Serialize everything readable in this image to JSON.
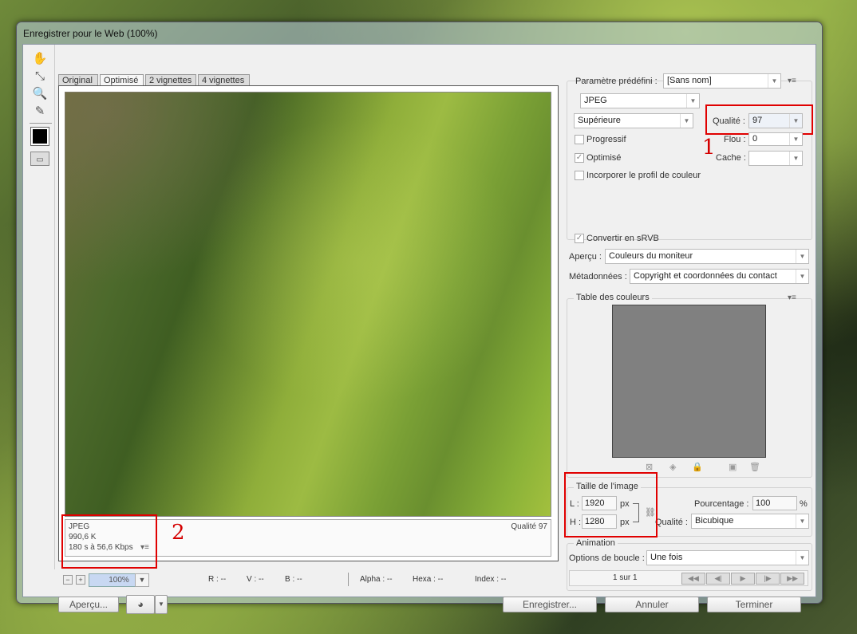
{
  "window": {
    "title": "Enregistrer pour le Web (100%)"
  },
  "tabs": [
    "Original",
    "Optimisé",
    "2 vignettes",
    "4 vignettes"
  ],
  "preview": {
    "info_format": "JPEG",
    "info_size": "990,6 K",
    "info_time": "180 s à 56,6 Kbps",
    "info_quality": "Qualité 97"
  },
  "status": {
    "zoom": "100%",
    "r": "R : --",
    "v": "V : --",
    "b": "B : --",
    "alpha": "Alpha : --",
    "hexa": "Hexa : --",
    "index": "Index : --"
  },
  "annotations": {
    "one": "1",
    "two": "2"
  },
  "settings": {
    "preset_label": "Paramètre prédéfini :",
    "preset_value": "[Sans nom]",
    "format": "JPEG",
    "quality_preset": "Supérieure",
    "quality_label": "Qualité :",
    "quality_value": "97",
    "progressive_label": "Progressif",
    "blur_label": "Flou :",
    "blur_value": "0",
    "optimized_label": "Optimisé",
    "matte_label": "Cache :",
    "matte_value": "",
    "icc_label": "Incorporer le profil de couleur",
    "srgb_label": "Convertir en sRVB",
    "preview_label": "Aperçu :",
    "preview_value": "Couleurs du moniteur",
    "metadata_label": "Métadonnées :",
    "metadata_value": "Copyright et coordonnées du contact"
  },
  "color_table": {
    "title": "Table des couleurs"
  },
  "image_size": {
    "title": "Taille de l'image",
    "w_label": "L :",
    "w_value": "1920",
    "h_label": "H :",
    "h_value": "1280",
    "unit": "px",
    "percent_label": "Pourcentage :",
    "percent_value": "100",
    "percent_unit": "%",
    "quality_label": "Qualité :",
    "quality_value": "Bicubique"
  },
  "animation": {
    "title": "Animation",
    "loop_label": "Options de boucle :",
    "loop_value": "Une fois",
    "frame_counter": "1 sur 1"
  },
  "buttons": {
    "preview": "Aperçu...",
    "save": "Enregistrer...",
    "cancel": "Annuler",
    "done": "Terminer"
  }
}
